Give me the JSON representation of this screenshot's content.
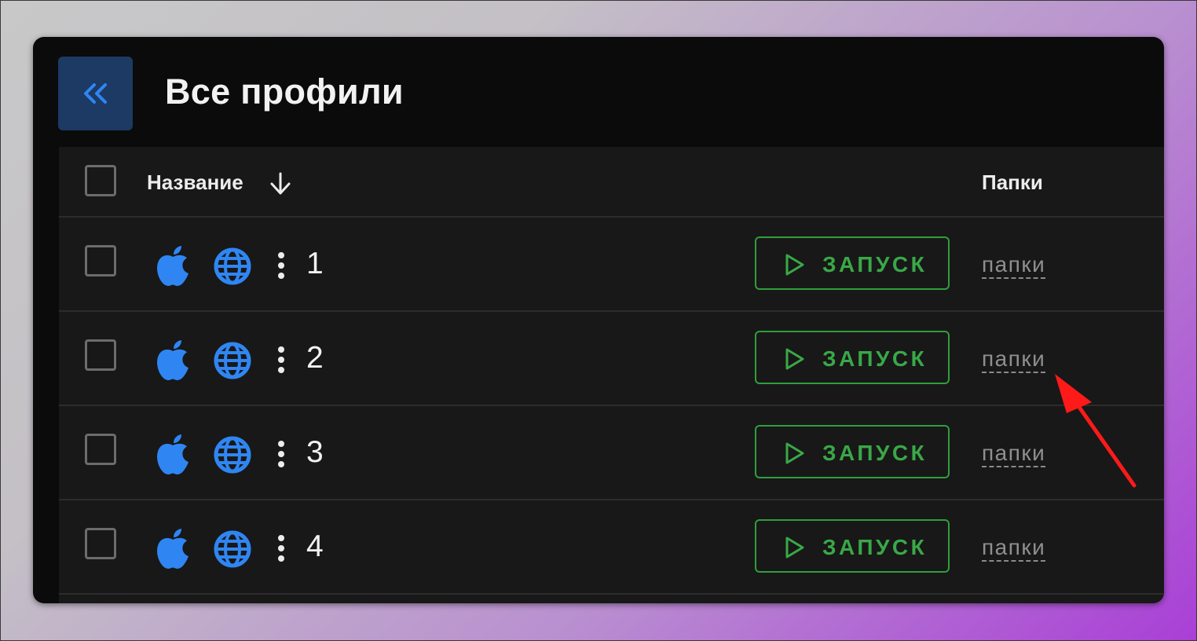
{
  "header": {
    "title": "Все профили",
    "back_icon": "double-chevron-left-icon"
  },
  "table": {
    "columns": {
      "name": "Название",
      "folders": "Папки"
    },
    "sort_icon": "arrow-down-icon",
    "rows": [
      {
        "name": "1",
        "os_icon": "apple-icon",
        "browser_icon": "globe-icon",
        "launch_label": "ЗАПУСК",
        "folders_label": "папки"
      },
      {
        "name": "2",
        "os_icon": "apple-icon",
        "browser_icon": "globe-icon",
        "launch_label": "ЗАПУСК",
        "folders_label": "папки"
      },
      {
        "name": "3",
        "os_icon": "apple-icon",
        "browser_icon": "globe-icon",
        "launch_label": "ЗАПУСК",
        "folders_label": "папки"
      },
      {
        "name": "4",
        "os_icon": "apple-icon",
        "browser_icon": "globe-icon",
        "launch_label": "ЗАПУСК",
        "folders_label": "папки"
      }
    ]
  },
  "colors": {
    "accent_blue": "#1e7af0",
    "launch_green": "#39a847",
    "annotation_red": "#ff1a1a"
  }
}
